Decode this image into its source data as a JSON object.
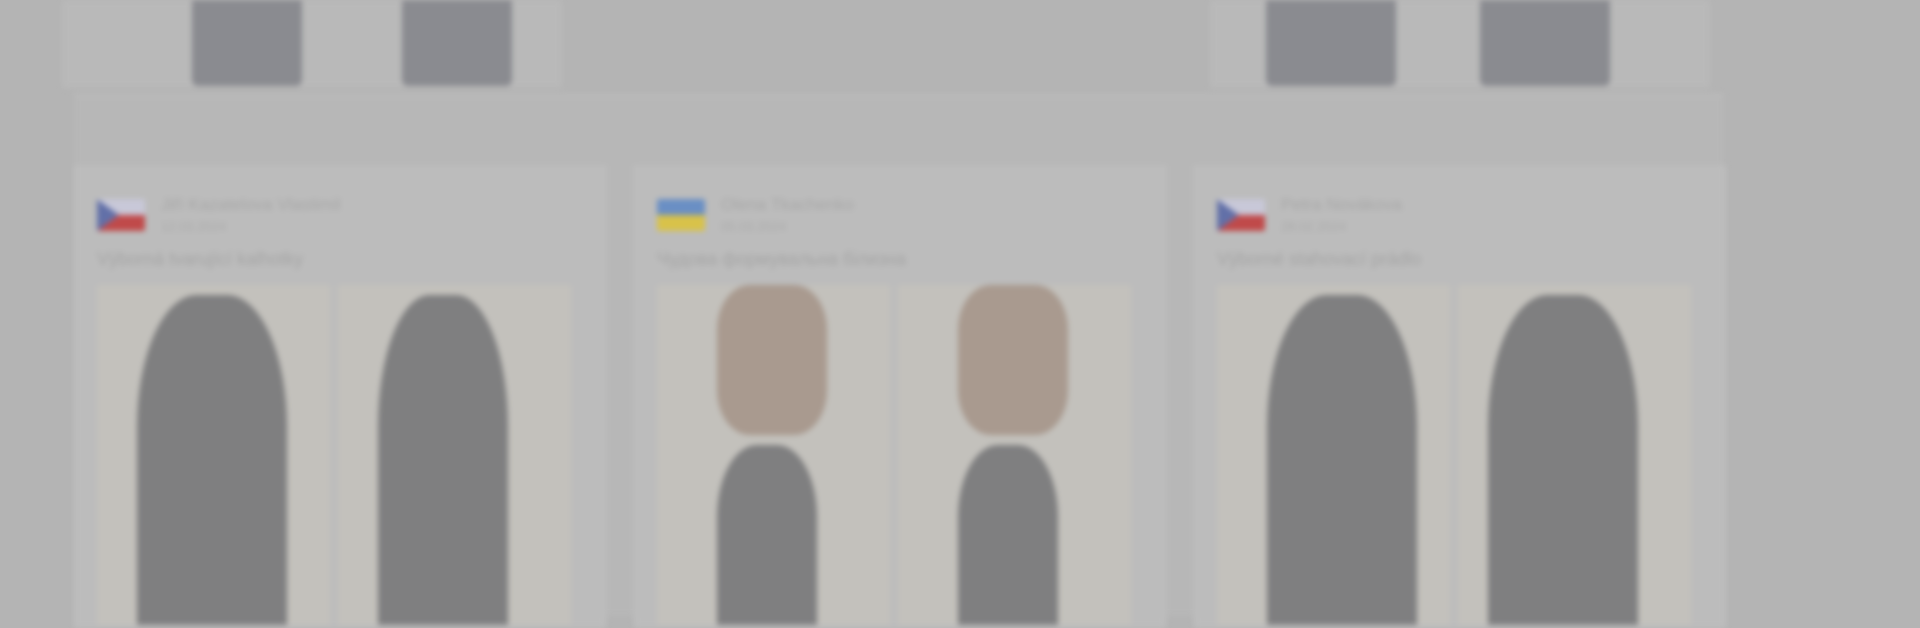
{
  "reviews": [
    {
      "flag": {
        "top": "#c8c8d8",
        "bottom": "#c04a4a",
        "triangle": "#6270a8"
      },
      "reviewer_name": "Jiří Kazatelova Vlastimil",
      "date": "12.03.2024",
      "title": "Výborná tvarující kalhotky",
      "photo_tone": "dark"
    },
    {
      "flag": {
        "top": "#6a8fc4",
        "bottom": "#d8c24a",
        "triangle": ""
      },
      "reviewer_name": "Olena Tkachenko",
      "date": "05.03.2024",
      "title": "Чудова формувальна білизна",
      "photo_tone": "skin"
    },
    {
      "flag": {
        "top": "#c8c8d8",
        "bottom": "#c04a4a",
        "triangle": "#6270a8"
      },
      "reviewer_name": "Petra Novákova",
      "date": "28.02.2024",
      "title": "Výborné stahovací prádlo",
      "photo_tone": "dark"
    }
  ]
}
